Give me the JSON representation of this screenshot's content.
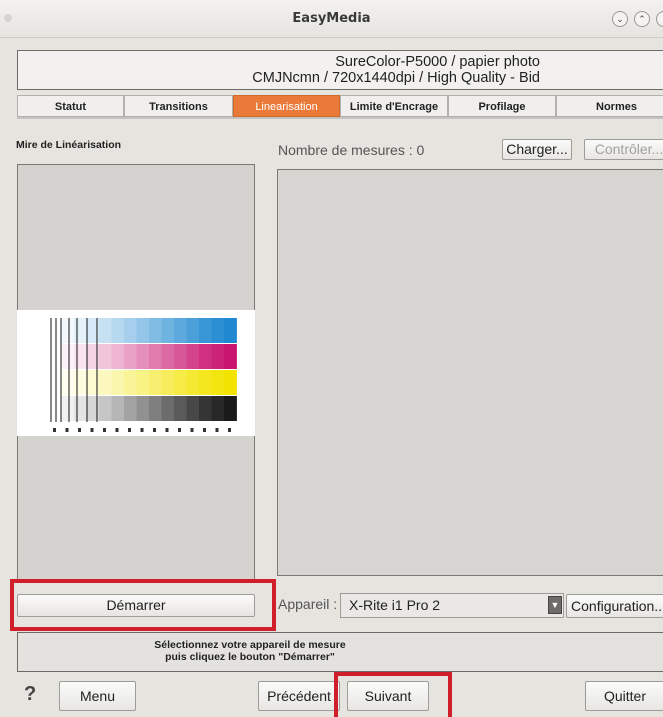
{
  "window": {
    "title": "EasyMedia",
    "controls": [
      "⌄",
      "⌃"
    ]
  },
  "header": {
    "line1": "SureColor-P5000 / papier photo",
    "line2": "CMJNcmn / 720x1440dpi / High Quality - Bid"
  },
  "tabs": [
    {
      "label": "Statut",
      "active": false
    },
    {
      "label": "Transitions",
      "active": false
    },
    {
      "label": "Linearisation",
      "active": true
    },
    {
      "label": "Limite d'Encrage",
      "active": false
    },
    {
      "label": "Profilage",
      "active": false
    },
    {
      "label": "Normes",
      "active": false
    }
  ],
  "left_panel": {
    "title": "Mire de Linéarisation",
    "start_button": "Démarrer"
  },
  "right_panel": {
    "count_label": "Nombre de mesures",
    "count_separator": ":",
    "count_value": "0",
    "load_button": "Charger...",
    "check_button": "Contrôler..."
  },
  "device": {
    "label": "Appareil",
    "separator": ":",
    "selected": "X-Rite i1 Pro 2",
    "config_button": "Configuration..."
  },
  "status": {
    "line1": "Sélectionnez votre appareil de mesure",
    "line2": "puis cliquez le bouton \"Démarrer\""
  },
  "bottom": {
    "help": "?",
    "menu": "Menu",
    "previous": "Précédent",
    "next": "Suivant",
    "quit": "Quitter"
  },
  "colors": {
    "active_tab": "#e97a3a",
    "highlight": "#d01f2a",
    "cyan": "#1e88d0",
    "magenta": "#c9156f",
    "yellow": "#f2e300",
    "black": "#1a1a1a"
  },
  "chart": {
    "rows": [
      "cyan",
      "magenta",
      "yellow",
      "black"
    ],
    "levels": [
      0,
      0.06,
      0.12,
      0.18,
      0.25,
      0.32,
      0.4,
      0.48,
      0.56,
      0.64,
      0.72,
      0.8,
      0.88,
      0.94,
      1.0
    ]
  }
}
